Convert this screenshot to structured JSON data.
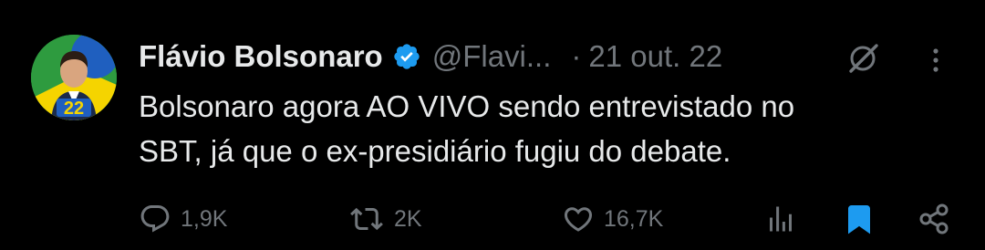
{
  "tweet": {
    "author_name": "Flávio Bolsonaro",
    "handle": "@Flavi...",
    "separator": "·",
    "timestamp": "21 out. 22",
    "text_lines": [
      "Bolsonaro agora AO VIVO sendo entrevistado no",
      "SBT, já que o ex-presidiário fugiu do debate."
    ],
    "avatar_number": "22"
  },
  "actions": {
    "reply_count": "1,9K",
    "retweet_count": "2K",
    "like_count": "16,7K"
  },
  "icons": {
    "verified": "verified-badge-icon",
    "grok": "grok-icon",
    "more": "more-options-icon",
    "reply": "reply-icon",
    "retweet": "retweet-icon",
    "like": "heart-icon",
    "views": "analytics-icon",
    "bookmark": "bookmark-icon",
    "share": "share-icon"
  },
  "colors": {
    "background": "#000000",
    "primary_text": "#e7e9ea",
    "secondary_text": "#71767b",
    "verified_blue": "#1d9bf0",
    "bookmark_blue": "#1d9bf0",
    "avatar_green": "#2e9b3f",
    "avatar_yellow": "#f5d400"
  }
}
